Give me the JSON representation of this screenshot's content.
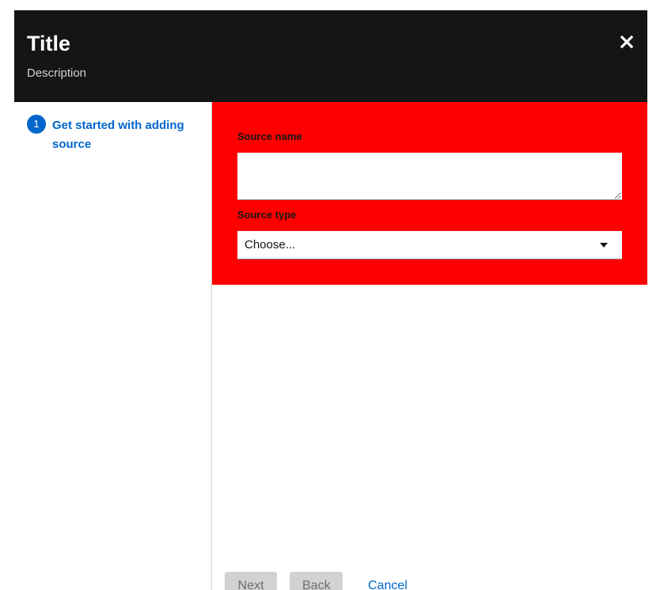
{
  "header": {
    "title": "Title",
    "description": "Description",
    "close_icon": "close-icon"
  },
  "nav": {
    "items": [
      {
        "number": "1",
        "label": "Get started with adding source",
        "current": true
      }
    ]
  },
  "form": {
    "source_name": {
      "label": "Source name",
      "value": ""
    },
    "source_type": {
      "label": "Source type",
      "selected": "Choose..."
    }
  },
  "footer": {
    "next_label": "Next",
    "back_label": "Back",
    "cancel_label": "Cancel"
  },
  "colors": {
    "header_bg": "#151515",
    "form_bg": "#ff0000",
    "accent": "#0066cc",
    "disabled_bg": "#d2d2d2"
  }
}
